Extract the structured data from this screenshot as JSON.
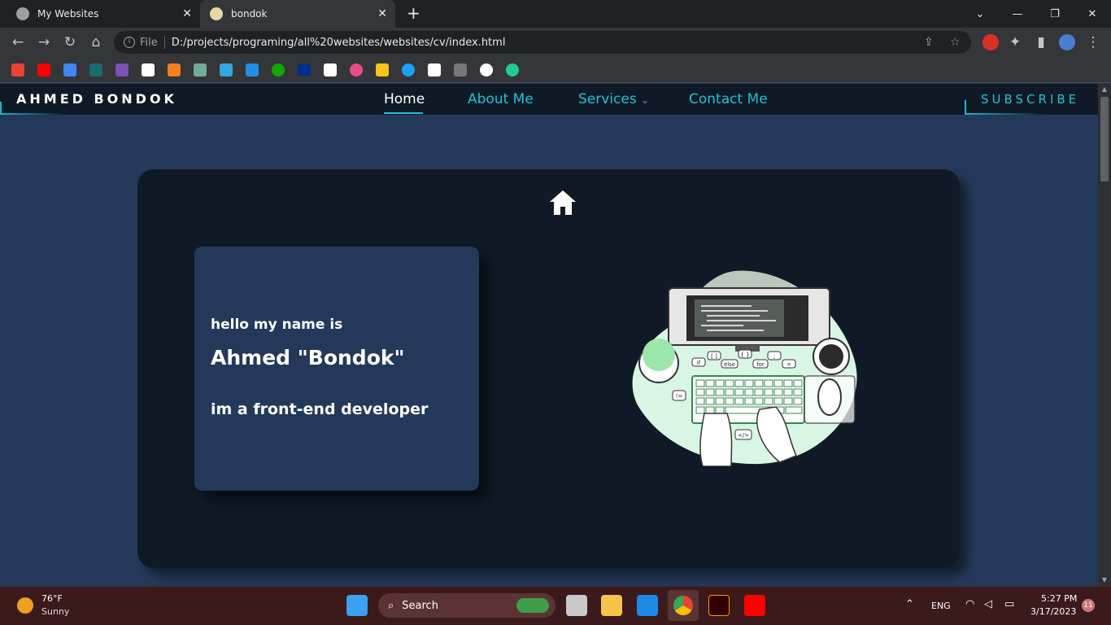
{
  "browser": {
    "tabs": [
      {
        "title": "My Websites",
        "active": false
      },
      {
        "title": "bondok",
        "active": true
      }
    ],
    "file_label": "File",
    "url": "D:/projects/programing/all%20websites/websites/cv/index.html"
  },
  "site": {
    "logo": "AHMED BONDOK",
    "nav": [
      {
        "label": "Home",
        "active": true
      },
      {
        "label": "About Me",
        "active": false
      },
      {
        "label": "Services",
        "active": false,
        "has_dropdown": true
      },
      {
        "label": "Contact Me",
        "active": false
      }
    ],
    "subscribe": "SUBSCRIBE",
    "intro": {
      "greeting": "hello my name is",
      "name": "Ahmed \"Bondok\"",
      "role": "im a front-end developer"
    },
    "illustration_code_labels": [
      "if",
      "[ ]",
      "{ }",
      "else",
      "for",
      ";",
      "=",
      "!=",
      "</>"
    ],
    "colors": {
      "accent": "#22c1d6",
      "background": "#24395a",
      "card": "#0f1a26"
    }
  },
  "taskbar": {
    "weather_temp": "76°F",
    "weather_condition": "Sunny",
    "search_label": "Search",
    "language": "ENG",
    "time": "5:27 PM",
    "date": "3/17/2023",
    "notification_count": "11"
  }
}
